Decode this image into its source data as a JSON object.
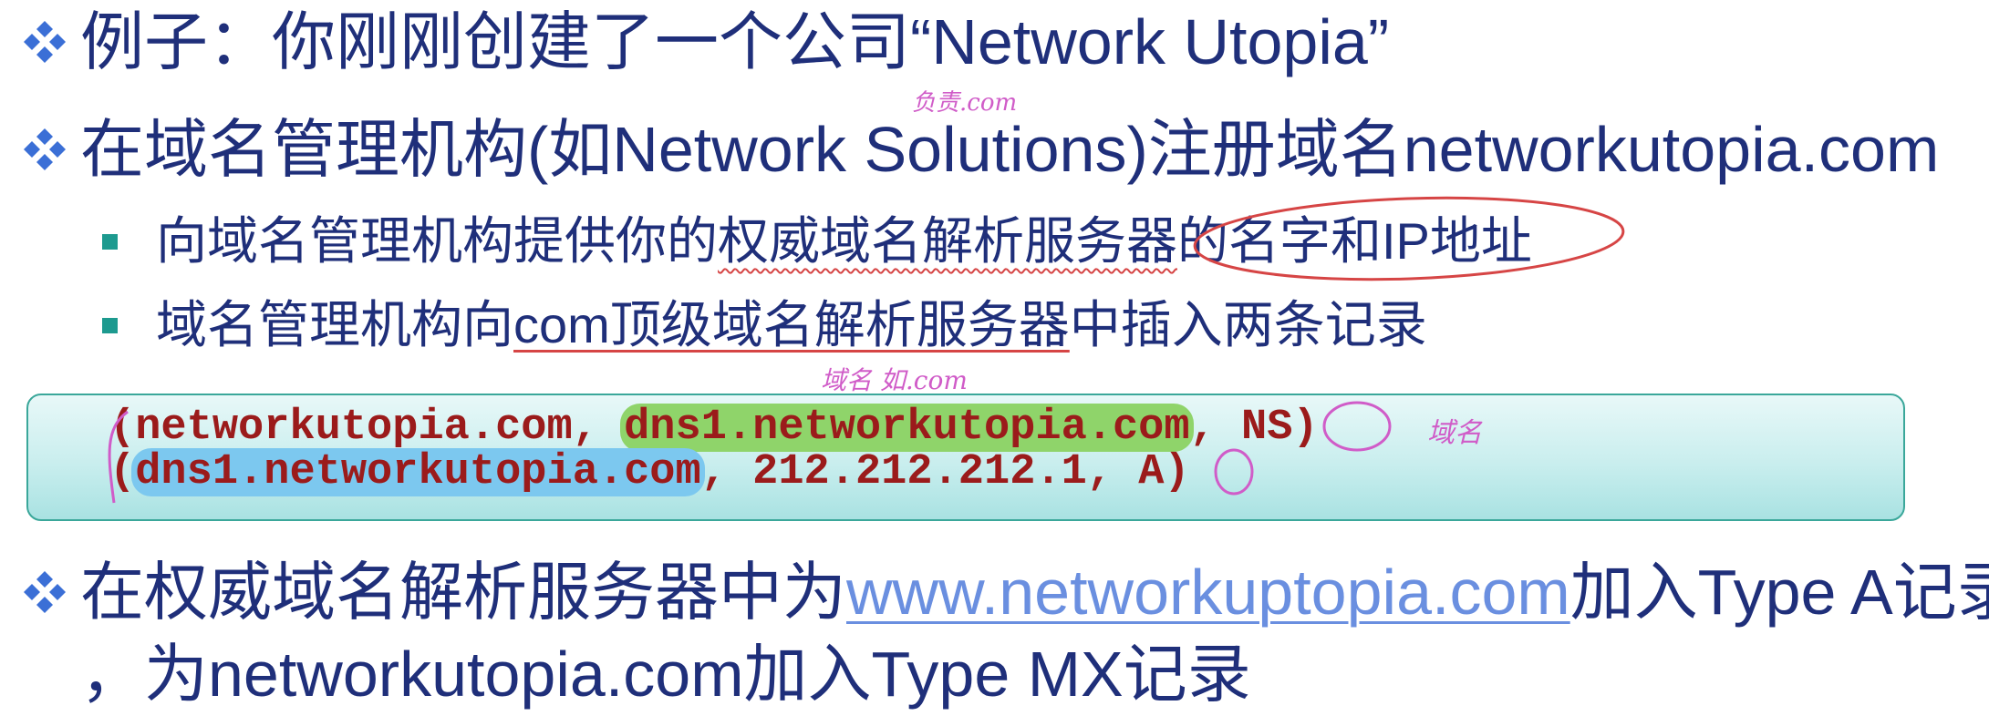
{
  "bullets": {
    "line1": {
      "prefix": "例子：你刚刚创建了一个公司 ",
      "company": "“Network Utopia”"
    },
    "line2": {
      "text_a": "在域名管理机构(如Network Solutions)注册域名networkutopia.com"
    },
    "sub1": {
      "text_a": "向域名管理机构提供你的",
      "text_wavy": "权威域名解析服务器",
      "text_b": "的名字和IP地址"
    },
    "sub2": {
      "text_a": "域名管理机构向",
      "text_ul": "com顶级域名解析服务器",
      "text_b": "中插入两条记录"
    },
    "records": {
      "r1_open": "(networkutopia.com, ",
      "r1_server": "dns1.networkutopia.com",
      "r1_close": ", NS)",
      "r2_open": "(",
      "r2_server": "dns1.networkutopia.com",
      "r2_close": ", 212.212.212.1, A)"
    },
    "line3": {
      "text_a": "在权威域名解析服务器中为",
      "link": "www.networkuptopia.com",
      "text_b": "加入Type A记录"
    },
    "line4": {
      "text": "，为networkutopia.com加入Type MX记录"
    }
  },
  "annotations": {
    "note_top": "负责.com",
    "note_mid": "域名 如.com",
    "note_right": "域名"
  },
  "colors": {
    "text": "#1f2f7a",
    "bullet_diamond": "#3b6fd6",
    "bullet_square": "#1d9a8f",
    "record_text": "#9b1b1b",
    "highlight_green": "#8fd46a",
    "highlight_blue": "#7cc8ef",
    "annotation": "#d05cc8",
    "ink_red": "#d64545"
  },
  "icons": {
    "level1_bullet": "four-diamond-icon",
    "level2_bullet": "square-bullet-icon"
  }
}
